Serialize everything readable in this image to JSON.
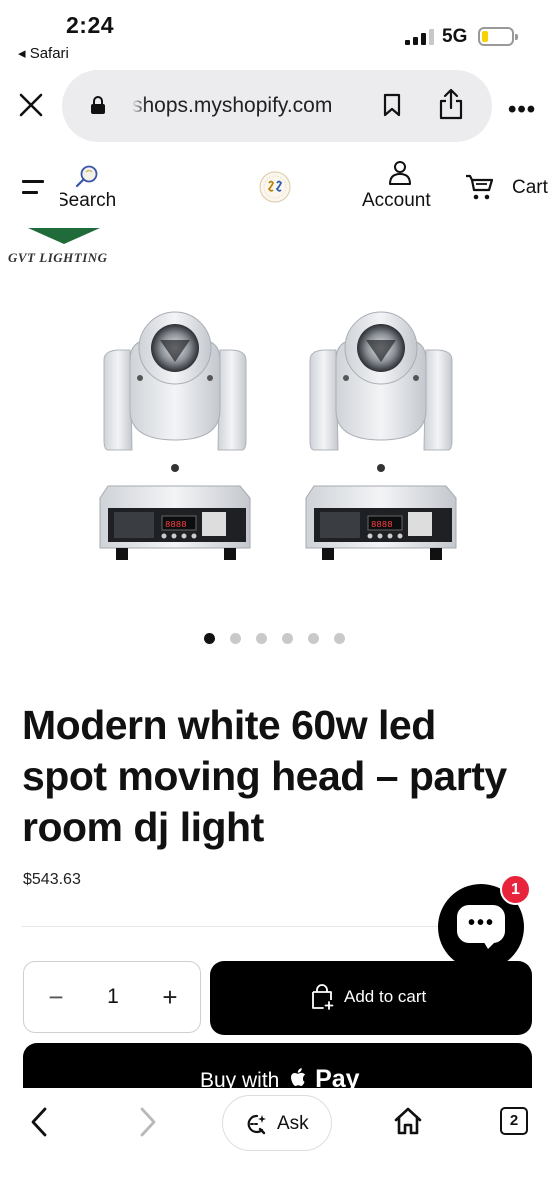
{
  "status_bar": {
    "time": "2:24",
    "back_app": "◂ Safari",
    "network": "5G",
    "battery_level": 0.2
  },
  "browser": {
    "url": "shops.myshopify.com",
    "icons": [
      "close-icon",
      "lock-icon",
      "bookmark-icon",
      "share-icon",
      "more-icon"
    ]
  },
  "store_header": {
    "search_label": "Search",
    "account_label": "Account",
    "cart_label": "Cart"
  },
  "brand": {
    "name": "GVT LIGHTING",
    "color": "#1f6b3a"
  },
  "gallery": {
    "image_count": 6,
    "active_index": 0
  },
  "product": {
    "title": "Modern white 60w led spot moving head – party room dj light",
    "price": "$543.63"
  },
  "chat": {
    "badge_count": "1",
    "badge_color": "#e8243c"
  },
  "purchase": {
    "quantity": "1",
    "minus_label": "−",
    "plus_label": "+",
    "add_to_cart_label": "Add to cart",
    "buy_label": "Buy with",
    "pay_label": "Pay"
  },
  "toolbar": {
    "ask_label": "Ask",
    "tab_count": "2"
  }
}
